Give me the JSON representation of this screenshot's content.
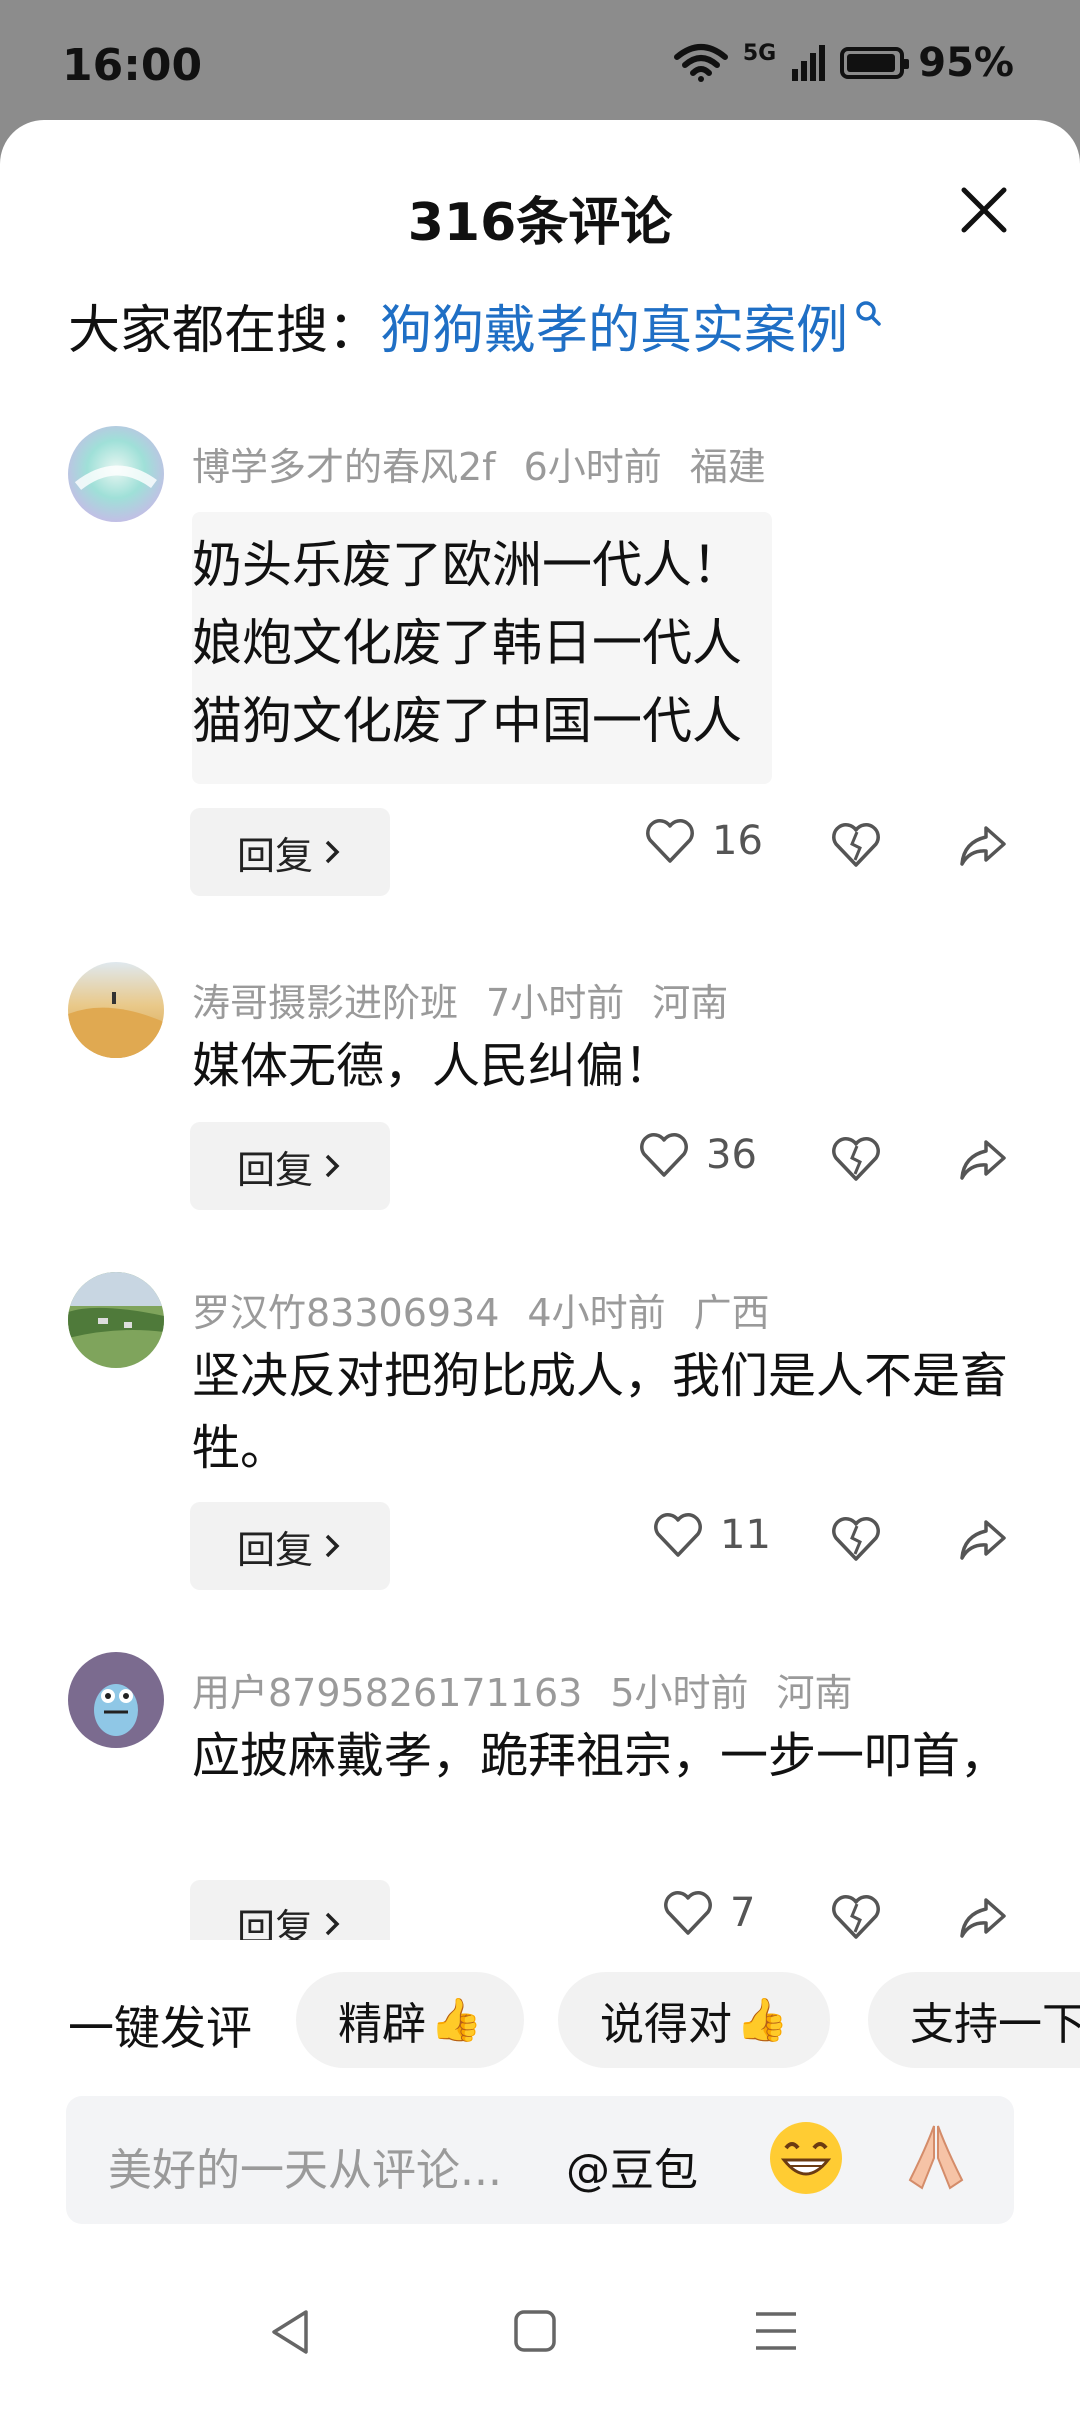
{
  "status_bar": {
    "time": "16:00",
    "battery": "95%",
    "network": "5G"
  },
  "sheet": {
    "title": "316条评论",
    "search_prefix": "大家都在搜：",
    "search_term": "狗狗戴孝的真实案例"
  },
  "comments": [
    {
      "username": "博学多才的春风2f",
      "time": "6小时前",
      "location": "福建",
      "image_lines": [
        "奶头乐废了欧洲一代人！",
        "娘炮文化废了韩日一代人",
        "猫狗文化废了中国一代人"
      ],
      "reply_label": "回复",
      "likes": "16"
    },
    {
      "username": "涛哥摄影进阶班",
      "time": "7小时前",
      "location": "河南",
      "text": "媒体无德，人民纠偏！",
      "reply_label": "回复",
      "likes": "36"
    },
    {
      "username": "罗汉竹83306934",
      "time": "4小时前",
      "location": "广西",
      "text": "坚决反对把狗比成人，我们是人不是畜牲。",
      "reply_label": "回复",
      "likes": "11"
    },
    {
      "username": "用户8795826171163",
      "time": "5小时前",
      "location": "河南",
      "text": "应披麻戴孝，跪拜祖宗，一步一叩首，",
      "reply_label": "回复",
      "likes": "7"
    }
  ],
  "quick_reply": {
    "label": "一键发评",
    "chips": [
      "精辟",
      "说得对",
      "支持一下"
    ]
  },
  "input": {
    "placeholder": "美好的一天从评论...",
    "bot_mention": "@豆包"
  },
  "icons": [
    "wifi-icon",
    "signal-icon",
    "battery-icon",
    "close-icon",
    "search-icon",
    "like-icon",
    "dislike-icon",
    "share-icon",
    "chevron-right-icon",
    "thumbs-up-icon",
    "grin-emoji-icon",
    "pray-emoji-icon",
    "nav-back-icon",
    "nav-home-icon",
    "nav-menu-icon"
  ],
  "colors": {
    "link": "#1f6fc5",
    "meta": "#9a9a9a",
    "chip_bg": "#f2f2f2",
    "overlay": "#8c8c8c"
  }
}
